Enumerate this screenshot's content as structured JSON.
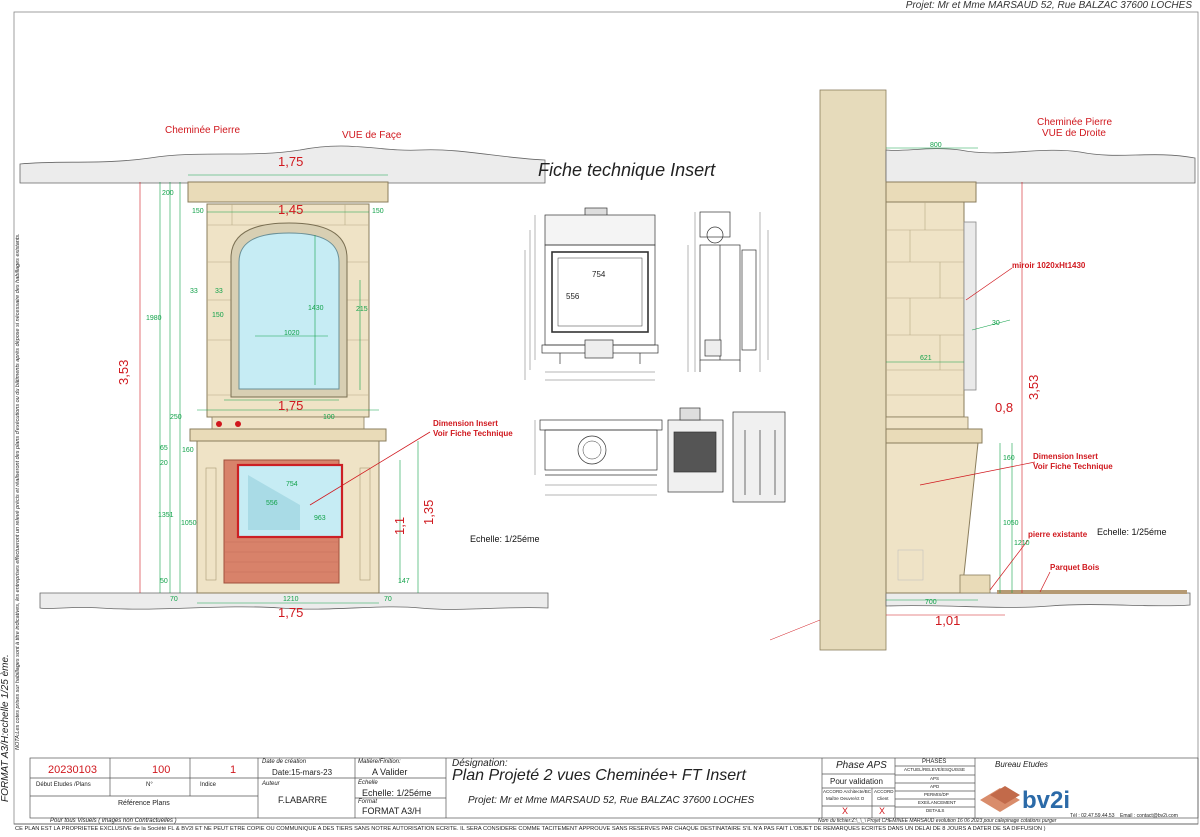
{
  "header": {
    "project_line": "Projet:  Mr et Mme MARSAUD 52, Rue BALZAC 37600 LOCHES"
  },
  "side_notes": {
    "format": "FORMAT A3/H:echelle 1/25 ème.",
    "nota": "NOTA:Les cotes prises sur habillages sont à titre indicatives, les entreprises effectueront un relevé précis et  réaliseront des plans d'exécutions ou du bâtiments après dépose si nécessaire des habillages existants."
  },
  "front_view": {
    "title": "Cheminée Pierre",
    "subtitle": "VUE de Façe",
    "dim_top": "1,75",
    "dim_upper": "1,45",
    "dim_mantel": "1,75",
    "dim_base": "1,75",
    "dim_height": "3,53",
    "dim_insert_h": "1,1",
    "dim_firebox_h": "1,35",
    "green": {
      "d200": "200",
      "d150a": "150",
      "d150b": "150",
      "d33a": "33",
      "d33b": "33",
      "d150c": "150",
      "d1980": "1980",
      "d1430": "1430",
      "d1020": "1020",
      "d215": "215",
      "d250": "250",
      "d100": "100",
      "d160": "160",
      "d20": "20",
      "d65": "65",
      "d1351": "1351",
      "d1050": "1050",
      "d754": "754",
      "d556": "556",
      "d963": "963",
      "d50": "50",
      "d147": "147",
      "d70a": "70",
      "d70b": "70",
      "d1210": "1210"
    },
    "insert_label_1": "Dimension Insert",
    "insert_label_2": "Voir Fiche Technique",
    "scale": "Echelle: 1/25éme"
  },
  "tech_sheet": {
    "title": "Fiche technique Insert",
    "d754": "754",
    "d556": "556"
  },
  "side_view": {
    "title": "Cheminée Pierre",
    "subtitle": "VUE de Droite",
    "dim_height": "3,53",
    "dim_depth": "0,8",
    "dim_base": "1,01",
    "green": {
      "d800": "800",
      "d30": "30",
      "d621": "621",
      "d160": "160",
      "d1050": "1050",
      "d700": "700",
      "d1210": "1210"
    },
    "mirror": "miroir 1020xHt1430",
    "insert_label_1": "Dimension Insert",
    "insert_label_2": "Voir Fiche Technique",
    "stone": "pierre existante",
    "parquet": "Parquet Bois",
    "scale": "Echelle: 1/25éme"
  },
  "title_block": {
    "date_code": "20230103",
    "num": "100",
    "index": "1",
    "lbl_debut": "Début Etudes /Plans",
    "lbl_n": "N°",
    "lbl_indice": "Indice",
    "lbl_ref": "Référence Plans",
    "lbl_date_creation": "Date de création",
    "date": "Date:15-mars-23",
    "lbl_auteur": "Auteur",
    "auteur": "F.LABARRE",
    "lbl_matiere": "Matière/Finition:",
    "matiere": "A Valider",
    "lbl_echelle": "Echelle",
    "echelle": "Echelle: 1/25éme",
    "lbl_format": "Format",
    "format": "FORMAT A3/H",
    "lbl_designation": "Désignation:",
    "designation": "Plan  Projeté 2 vues Cheminée+  FT Insert",
    "projet": "Projet:  Mr et Mme MARSAUD 52, Rue BALZAC 37600 LOCHES",
    "phase": "Phase  APS",
    "validation": "Pour validation",
    "accord_1": "ACCORD Architecte/BC",
    "accord_2": "Maître Oeuvre/ct O",
    "accord_3": "ACCORD",
    "accord_4": "Client",
    "x1": "X",
    "x2": "X",
    "phases_title": "PHASES",
    "phases": [
      "ACTUEL/RELEVE/ESQUISSE",
      "APS",
      "APD",
      "PERMIS/DP",
      "EXE/LANCEMENT",
      "DETAILS"
    ],
    "bureau": "Bureau Etudes",
    "logo": "bv2i",
    "contact": "Email : contact@bv2i.com",
    "tel": "Tél : 02.47.59.44.53",
    "visuels": "Pour tous Visuels ( images  non Contractuelles )",
    "filename": "Nom du fichier:Z:\\_\\_\\  Projet  CHEMINEE MARSAUD evolution 16 06 2023 pour calepinage cotations purger",
    "legal": "CE PLAN EST LA PROPRIETEE EXCLUSIVE  de la Société FL & BV2I ET NE PEUT ETRE COPIE OU COMMUNIQUE A  DES TIERS SANS NOTRE AUTORISATION ECRITE. IL SERA CONSIDERE COMME TACITEMENT APPROUVE SANS RESERVES PAR CHAQUE DESTINATAIRE S'IL N'A PAS FAIT L'OBJET DE REMARQUES ECRITES DANS UN DELAI DE 8 JOURS A DATER DE SA DIFFUSION )"
  }
}
